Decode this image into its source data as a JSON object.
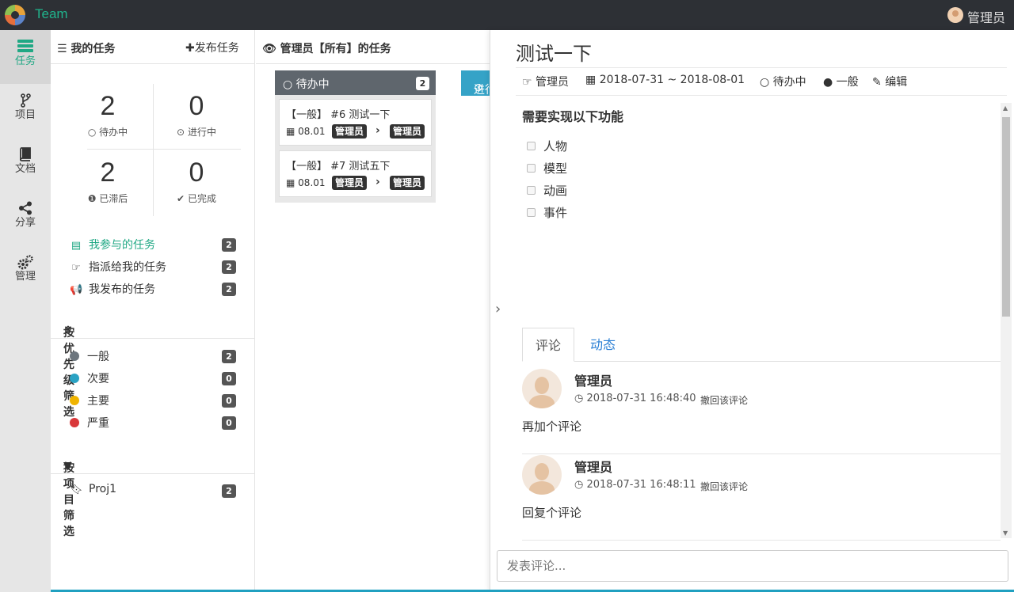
{
  "app": {
    "title": "Team",
    "user": "管理员"
  },
  "nav": [
    {
      "label": "任务",
      "icon": "tasks-icon"
    },
    {
      "label": "项目",
      "icon": "branch-icon"
    },
    {
      "label": "文档",
      "icon": "book-icon"
    },
    {
      "label": "分享",
      "icon": "share-icon"
    },
    {
      "label": "管理",
      "icon": "gears-icon"
    }
  ],
  "panel": {
    "title": "我的任务",
    "publish": "发布任务",
    "stats": [
      {
        "num": "2",
        "label": "待办中",
        "icon": "circle-icon"
      },
      {
        "num": "0",
        "label": "进行中",
        "icon": "dot-circle-icon"
      },
      {
        "num": "2",
        "label": "已滞后",
        "icon": "exclamation-circle-icon"
      },
      {
        "num": "0",
        "label": "已完成",
        "icon": "check-circle-icon"
      }
    ],
    "filters": [
      {
        "label": "我参与的任务",
        "count": "2"
      },
      {
        "label": "指派给我的任务",
        "count": "2"
      },
      {
        "label": "我发布的任务",
        "count": "2"
      }
    ],
    "priority_title": "按优先级筛选",
    "priorities": [
      {
        "label": "一般",
        "count": "2",
        "color": "#6c757d"
      },
      {
        "label": "次要",
        "count": "0",
        "color": "#2aa3c4"
      },
      {
        "label": "主要",
        "count": "0",
        "color": "#f0b400"
      },
      {
        "label": "严重",
        "count": "0",
        "color": "#d9383a"
      }
    ],
    "project_title": "按项目筛选",
    "projects": [
      {
        "label": "Proj1",
        "count": "2"
      }
    ]
  },
  "board": {
    "title": "管理员【所有】的任务",
    "columns": [
      {
        "title": "待办中",
        "count": "2",
        "cards": [
          {
            "title": "【一般】 #6 测试一下",
            "date": "08.01",
            "from": "管理员",
            "to": "管理员"
          },
          {
            "title": "【一般】 #7 测试五下",
            "date": "08.01",
            "from": "管理员",
            "to": "管理员"
          }
        ]
      },
      {
        "title": "进行中"
      }
    ]
  },
  "detail": {
    "title": "测试一下",
    "creator": "管理员",
    "date_range": "2018-07-31 ~ 2018-08-01",
    "status": "待办中",
    "priority": "一般",
    "edit": "编辑",
    "heading": "需要实现以下功能",
    "checklist": [
      "人物",
      "模型",
      "动画",
      "事件"
    ],
    "tabs": [
      "评论",
      "动态"
    ],
    "comments": [
      {
        "author": "管理员",
        "time": "2018-07-31 16:48:40",
        "retract": "撤回该评论",
        "text": "再加个评论"
      },
      {
        "author": "管理员",
        "time": "2018-07-31 16:48:11",
        "retract": "撤回该评论",
        "text": "回复个评论"
      }
    ],
    "comment_placeholder": "发表评论..."
  }
}
